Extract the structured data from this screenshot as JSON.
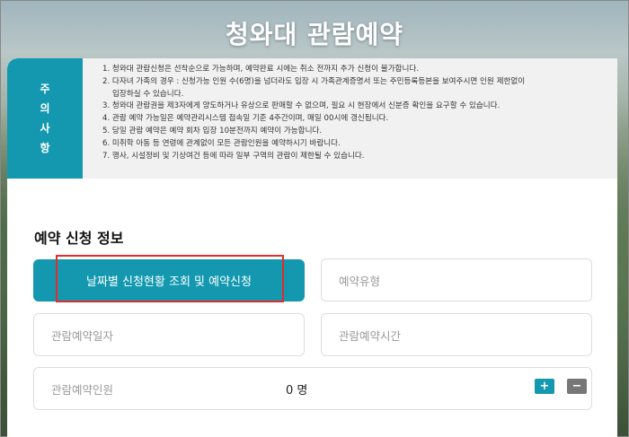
{
  "header": {
    "title": "청와대 관람예약"
  },
  "notice": {
    "tab_chars": [
      "주",
      "의",
      "사",
      "항"
    ],
    "lines": [
      "1. 청와대 관람신청은 선착순으로 가능하며, 예약완료 시에는 취소 전까지 추가 신청이 불가합니다.",
      "2. 다자녀 가족의 경우 : 신청가능 인원 수(6명)을 넘더라도 입장 시 가족관계증명서 또는 주민등록등본을 보여주시면 인원 제한없이",
      "입장하실 수 있습니다.",
      "3. 청와대 관람권을 제3자에게 양도하거나 유상으로 판매할 수 없으며, 필요 시 현장에서 신분증 확인을 요구할 수 있습니다.",
      "4. 관람 예약 가능일은 예약관리시스템 접속일 기준 4주간이며, 매일 00시에 갱신됩니다.",
      "5. 당일 관람 예약은 예약 회차 입장 10분전까지 예약이 가능합니다.",
      "6. 미취학 아동 등 연령에 관계없이 모든 관람인원을 예약하시기 바랍니다.",
      "7. 행사, 시설정비 및 기상여건 등에 따라 일부 구역의 관람이 제한될 수 있습니다."
    ]
  },
  "form": {
    "section_title": "예약 신청 정보",
    "date_status_button": "날짜별 신청현황 조회 및 예약신청",
    "reservation_type": "예약유형",
    "visit_date": "관람예약일자",
    "visit_time": "관람예약시간",
    "visitors_label": "관람예약인원",
    "visitors_count": "0",
    "visitors_unit": "명",
    "plus_label": "+",
    "minus_label": "−"
  },
  "colors": {
    "accent": "#1398b0",
    "highlight": "#e52b2b"
  }
}
